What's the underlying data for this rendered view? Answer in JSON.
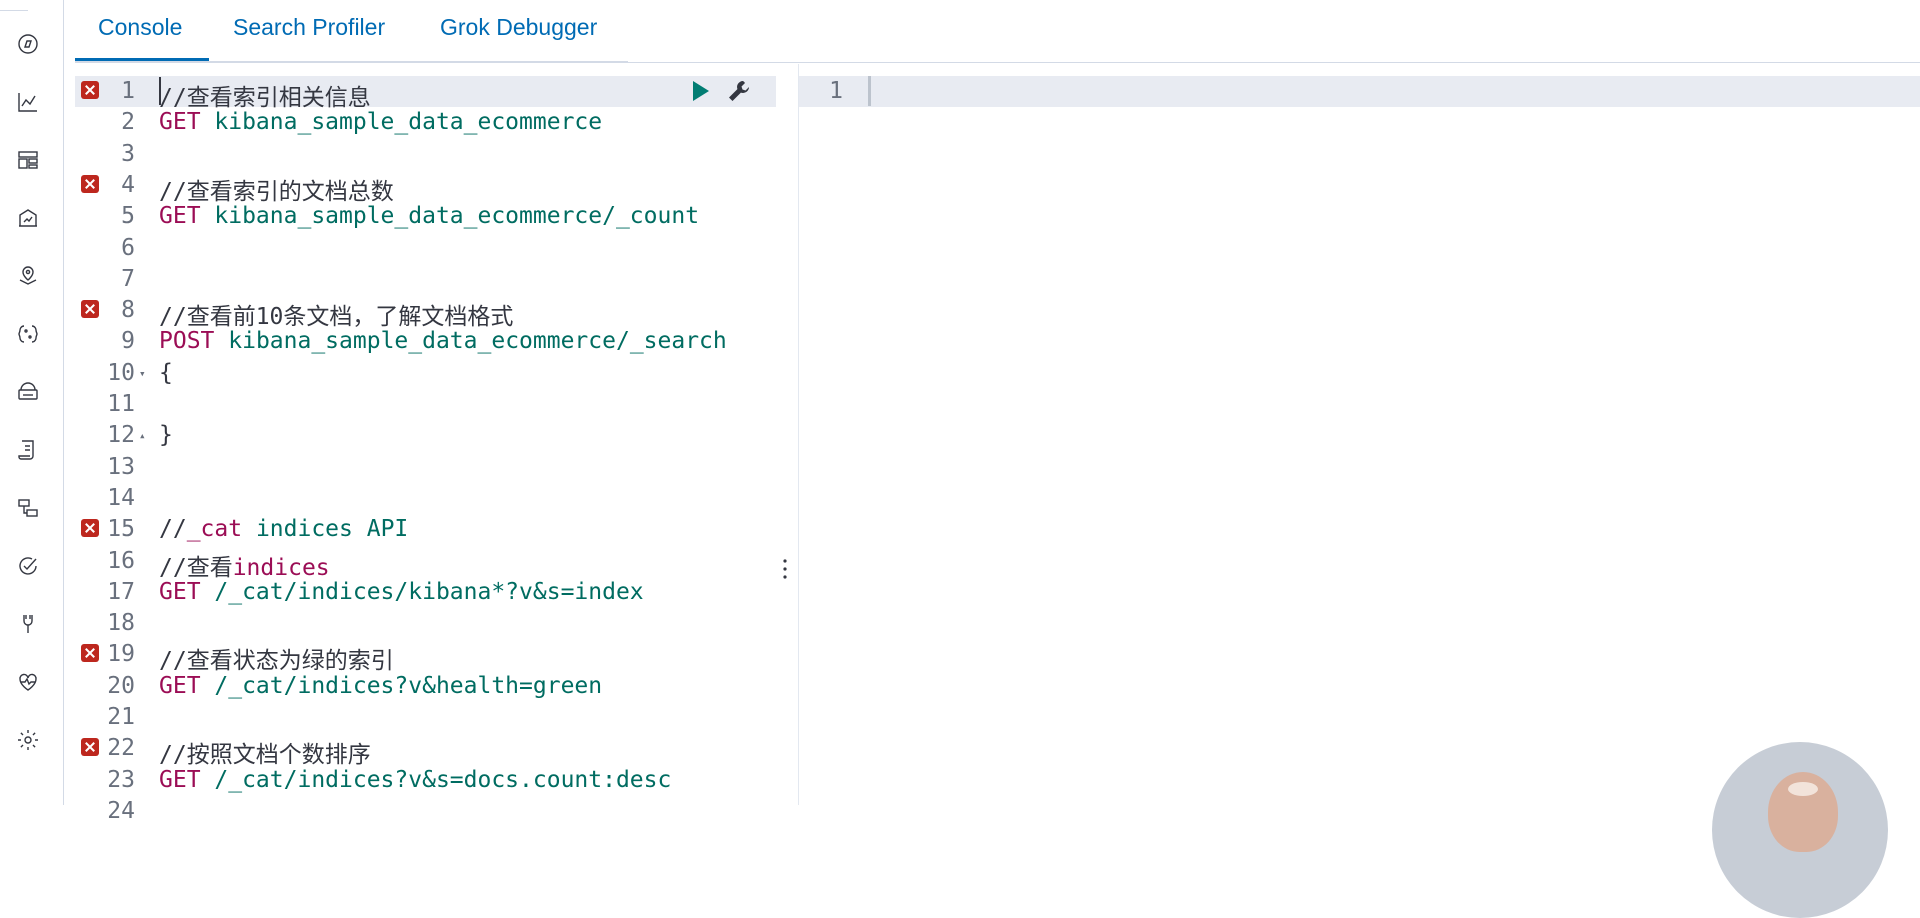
{
  "sidebar": {
    "icons": [
      "discover-icon",
      "visualize-icon",
      "dashboard-icon",
      "canvas-icon",
      "maps-icon",
      "machine-learning-icon",
      "infrastructure-icon",
      "logs-icon",
      "apm-icon",
      "uptime-icon",
      "dev-tools-icon",
      "monitoring-icon",
      "management-icon"
    ]
  },
  "tabs": [
    {
      "label": "Console",
      "active": true
    },
    {
      "label": "Search Profiler",
      "active": false
    },
    {
      "label": "Grok Debugger",
      "active": false
    }
  ],
  "editor": {
    "lines": [
      {
        "n": "1",
        "error": true,
        "parts": [
          {
            "t": "//查看索引相关信息",
            "c": "comment"
          }
        ]
      },
      {
        "n": "2",
        "error": false,
        "parts": [
          {
            "t": "GET ",
            "c": "method"
          },
          {
            "t": "kibana_sample_data_ecommerce",
            "c": "url"
          }
        ]
      },
      {
        "n": "3",
        "error": false,
        "parts": []
      },
      {
        "n": "4",
        "error": true,
        "parts": [
          {
            "t": "//查看索引的文档总数",
            "c": "comment"
          }
        ]
      },
      {
        "n": "5",
        "error": false,
        "parts": [
          {
            "t": "GET ",
            "c": "method"
          },
          {
            "t": "kibana_sample_data_ecommerce/_count",
            "c": "url"
          }
        ]
      },
      {
        "n": "6",
        "error": false,
        "parts": []
      },
      {
        "n": "7",
        "error": false,
        "parts": []
      },
      {
        "n": "8",
        "error": true,
        "parts": [
          {
            "t": "//查看前10条文档，了解文档格式",
            "c": "comment"
          }
        ]
      },
      {
        "n": "9",
        "error": false,
        "parts": [
          {
            "t": "POST ",
            "c": "method"
          },
          {
            "t": "kibana_sample_data_ecommerce/_search",
            "c": "url"
          }
        ]
      },
      {
        "n": "10",
        "error": false,
        "fold": "▾",
        "parts": [
          {
            "t": "{",
            "c": "comment"
          }
        ]
      },
      {
        "n": "11",
        "error": false,
        "parts": []
      },
      {
        "n": "12",
        "error": false,
        "fold": "▴",
        "parts": [
          {
            "t": "}",
            "c": "comment"
          }
        ]
      },
      {
        "n": "13",
        "error": false,
        "parts": []
      },
      {
        "n": "14",
        "error": false,
        "parts": []
      },
      {
        "n": "15",
        "error": true,
        "parts": [
          {
            "t": "//",
            "c": "comment"
          },
          {
            "t": "_cat",
            "c": "method"
          },
          {
            "t": " indices API",
            "c": "url"
          }
        ]
      },
      {
        "n": "16",
        "error": false,
        "parts": [
          {
            "t": "//查看",
            "c": "comment"
          },
          {
            "t": "indices",
            "c": "method"
          }
        ]
      },
      {
        "n": "17",
        "error": false,
        "parts": [
          {
            "t": "GET ",
            "c": "method"
          },
          {
            "t": "/_cat/indices/kibana*?v&s=index",
            "c": "url"
          }
        ]
      },
      {
        "n": "18",
        "error": false,
        "parts": []
      },
      {
        "n": "19",
        "error": true,
        "parts": [
          {
            "t": "//查看状态为绿的索引",
            "c": "comment"
          }
        ]
      },
      {
        "n": "20",
        "error": false,
        "parts": [
          {
            "t": "GET ",
            "c": "method"
          },
          {
            "t": "/_cat/indices?v&health=green",
            "c": "url"
          }
        ]
      },
      {
        "n": "21",
        "error": false,
        "parts": []
      },
      {
        "n": "22",
        "error": true,
        "parts": [
          {
            "t": "//按照文档个数排序",
            "c": "comment"
          }
        ]
      },
      {
        "n": "23",
        "error": false,
        "parts": [
          {
            "t": "GET ",
            "c": "method"
          },
          {
            "t": "/_cat/indices?v&s=docs.count:desc",
            "c": "url"
          }
        ]
      },
      {
        "n": "24",
        "error": false,
        "parts": []
      }
    ]
  },
  "output": {
    "line_number": "1"
  },
  "colors": {
    "accent": "#006bb4",
    "method": "#9b0d55",
    "url": "#006c61",
    "error": "#bd271e",
    "run": "#017d73"
  }
}
